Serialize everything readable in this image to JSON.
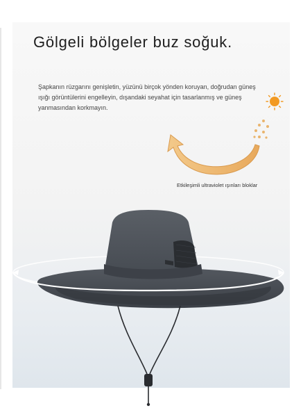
{
  "headline": "Gölgeli bölgeler buz soğuk.",
  "description": "Şapkanın rüzgarını genişletin, yüzünü birçok yönden koruyan, doğrudan güneş ışığı görüntülerini engelleyin, dışandaki seyahat için tasarlanmış ve güneş yanmasından korkmayın.",
  "uv_caption": "Etkileşimli ultraviolet ışınları bloklar",
  "colors": {
    "sun": "#f29a23",
    "uv_arrow": "#efbf74",
    "hat": "#4c5158",
    "hat_dark": "#2f3338",
    "ring": "#ffffff"
  },
  "icons": [
    "sun-icon",
    "uv-arrow-icon"
  ]
}
